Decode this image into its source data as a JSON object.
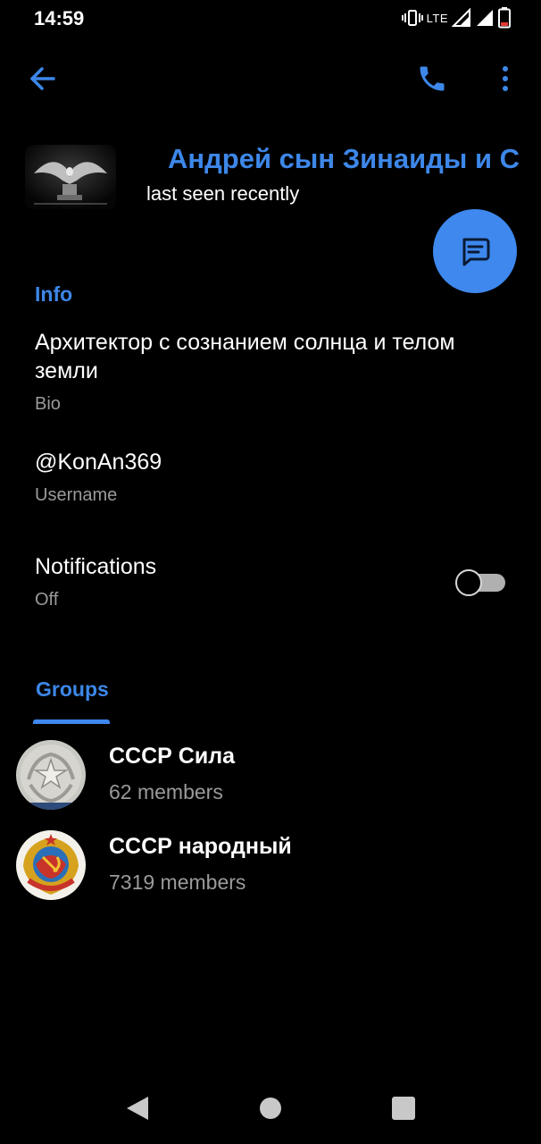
{
  "status_bar": {
    "time": "14:59",
    "network": "LTE",
    "icons": [
      "vibrate-icon",
      "signal-icon",
      "signal-icon",
      "battery-low-icon"
    ]
  },
  "app_bar": {
    "icons": [
      "back-arrow-icon",
      "phone-icon",
      "more-vert-icon"
    ]
  },
  "profile": {
    "name": "Андрей сын Зинаиды и С",
    "status": "last seen recently"
  },
  "fab": {
    "icon": "message-icon"
  },
  "info": {
    "title": "Info",
    "bio": "Архитектор с сознанием солнца и телом земли",
    "bio_label": "Bio",
    "username": "@KonAn369",
    "username_label": "Username",
    "notifications": "Notifications",
    "notifications_state": "Off",
    "notifications_enabled": false
  },
  "groups": {
    "tab_label": "Groups",
    "items": [
      {
        "name": "СССР Сила",
        "members": "62 members"
      },
      {
        "name": "СССР народный",
        "members": "7319 members"
      }
    ]
  },
  "nav_bar": {
    "icons": [
      "nav-back-icon",
      "nav-home-icon",
      "nav-recents-icon"
    ]
  },
  "colors": {
    "accent": "#3d87e8",
    "fab": "#3e88ee",
    "background": "#000000",
    "secondary_text": "#9a9a9a"
  }
}
